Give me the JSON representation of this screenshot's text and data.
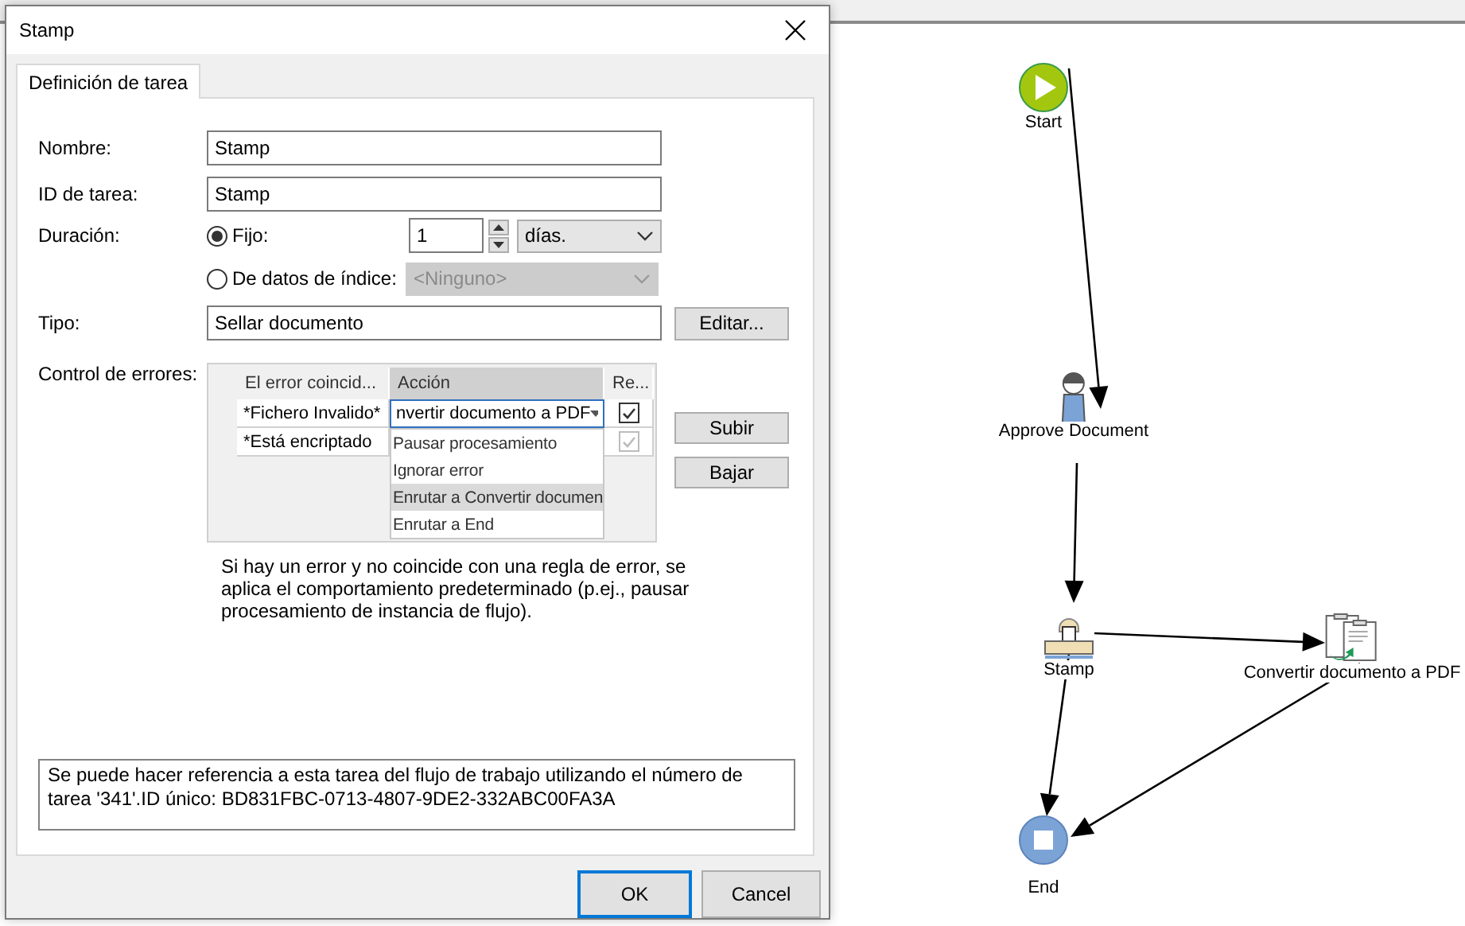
{
  "window": {
    "title": "Stamp"
  },
  "tabs": [
    {
      "label": "Definición de tarea",
      "selected": true
    }
  ],
  "form": {
    "name": {
      "label": "Nombre:",
      "value": "Stamp"
    },
    "task_id": {
      "label": "ID de tarea:",
      "value": "Stamp"
    },
    "duration": {
      "label": "Duración:",
      "options": [
        {
          "label": "Fijo:",
          "selected": true
        },
        {
          "label": "De datos de índice:",
          "selected": false
        }
      ],
      "amount": "1",
      "unit": "días.",
      "index_field": {
        "value": "<Ninguno>",
        "disabled": true
      }
    },
    "type": {
      "label": "Tipo:",
      "value": "Sellar documento",
      "button": "Editar..."
    },
    "error_control": {
      "label": "Control de errores:",
      "columns": [
        {
          "label": "El error coincid...",
          "selected": false
        },
        {
          "label": "Acción",
          "selected": true
        },
        {
          "label": "Re...",
          "selected": false
        }
      ],
      "rows": [
        {
          "match": "*Fichero Invalido*",
          "action": "nvertir documento a PDF",
          "checked": true,
          "disabled": false
        },
        {
          "match": "*Está encriptado",
          "checked": true,
          "disabled": true
        }
      ],
      "dropdown": [
        {
          "label": "Pausar procesamiento",
          "selected": false
        },
        {
          "label": "Ignorar error",
          "selected": false
        },
        {
          "label": "Enrutar a Convertir documen",
          "selected": true
        },
        {
          "label": "Enrutar a End",
          "selected": false
        }
      ],
      "buttons": [
        "Subir",
        "Bajar"
      ],
      "note": "Si hay un error y no coincide con una regla de error, se aplica el comportamiento predeterminado (p.ej., pausar procesamiento de instancia de flujo)."
    },
    "info": "Se puede hacer referencia a esta tarea del flujo de trabajo utilizando el número de tarea '341'.ID único: BD831FBC-0713-4807-9DE2-332ABC00FA3A"
  },
  "footer_buttons": [
    {
      "label": "OK",
      "default": true
    },
    {
      "label": "Cancel",
      "default": false
    }
  ],
  "diagram": {
    "nodes": [
      {
        "kind": "start",
        "label": "Start"
      },
      {
        "kind": "user",
        "label": "Approve Document"
      },
      {
        "kind": "stamp",
        "label": "Stamp"
      },
      {
        "kind": "convert",
        "label": "Convertir documento a PDF"
      },
      {
        "kind": "end",
        "label": "End"
      }
    ]
  }
}
